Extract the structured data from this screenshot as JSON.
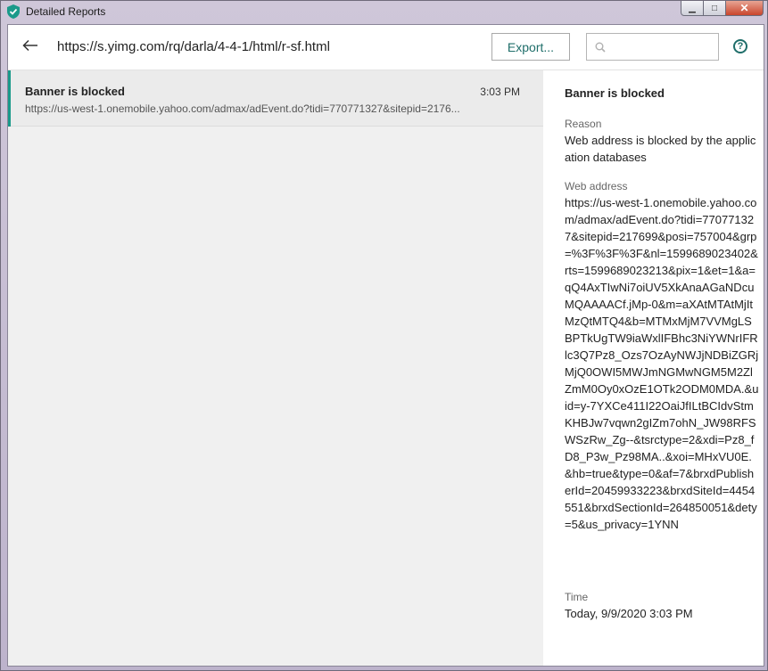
{
  "window": {
    "title": "Detailed Reports",
    "minimize_glyph": "▁",
    "maximize_glyph": "□",
    "close_glyph": "✕"
  },
  "toolbar": {
    "url": "https://s.yimg.com/rq/darla/4-4-1/html/r-sf.html",
    "export_label": "Export...",
    "search_value": "",
    "search_placeholder": "",
    "help_glyph": "?"
  },
  "colors": {
    "accent": "#1a9a8a",
    "brand_text": "#1f6e6a"
  },
  "list": {
    "items": [
      {
        "title": "Banner is blocked",
        "time": "3:03 PM",
        "url": "https://us-west-1.onemobile.yahoo.com/admax/adEvent.do?tidi=770771327&sitepid=2176..."
      }
    ]
  },
  "details": {
    "title": "Banner is blocked",
    "reason_label": "Reason",
    "reason_value": "Web address is blocked by the application databases",
    "web_address_label": "Web address",
    "web_address_value": "https://us-west-1.onemobile.yahoo.com/admax/adEvent.do?tidi=770771327&sitepid=217699&posi=757004&grp=%3F%3F%3F&nl=1599689023402&rts=1599689023213&pix=1&et=1&a=qQ4AxTIwNi7oiUV5XkAnaAGaNDcuMQAAAACf.jMp-0&m=aXAtMTAtMjItMzQtMTQ4&b=MTMxMjM7VVMgLSBPTkUgTW9iaWxlIFBhc3NiYWNrIFRlc3Q7Pz8_Ozs7OzAyNWJjNDBiZGRjMjQ0OWI5MWJmNGMwNGM5M2ZlZmM0Oy0xOzE1OTk2ODM0MDA.&uid=y-7YXCe411I22OaiJfILtBCIdvStmKHBJw7vqwn2gIZm7ohN_JW98RFSWSzRw_Zg--&tsrctype=2&xdi=Pz8_fD8_P3w_Pz98MA..&xoi=MHxVU0E.&hb=true&type=0&af=7&brxdPublisherId=20459933223&brxdSiteId=4454551&brxdSectionId=264850051&dety=5&us_privacy=1YNN",
    "time_label": "Time",
    "time_value": "Today, 9/9/2020 3:03 PM"
  }
}
